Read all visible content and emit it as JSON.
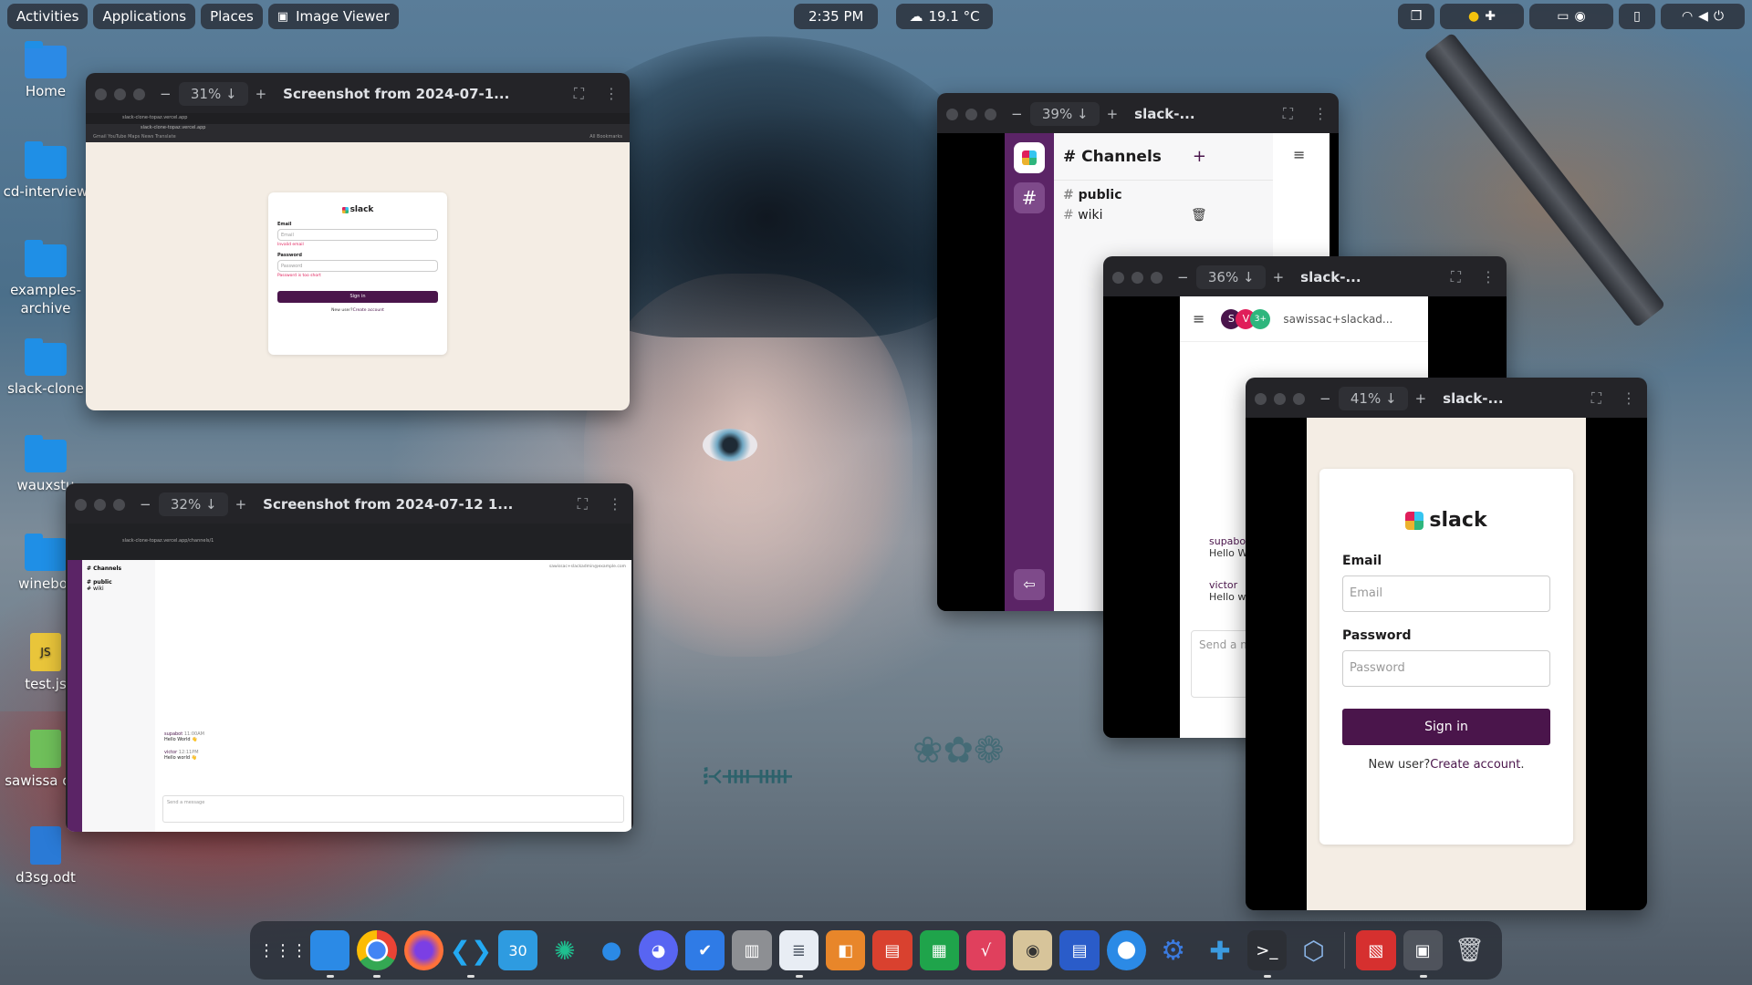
{
  "topbar": {
    "activities": "Activities",
    "applications": "Applications",
    "places": "Places",
    "app_indicator": "Image Viewer",
    "clock": "2:35 PM",
    "weather": "19.1 °C"
  },
  "desktop_icons": [
    {
      "label": "Home"
    },
    {
      "label": "cd-interview"
    },
    {
      "label": "examples-archive"
    },
    {
      "label": "slack-clone"
    },
    {
      "label": "wauxstu"
    },
    {
      "label": "winebot"
    },
    {
      "label": "test.js",
      "badge": "JS"
    },
    {
      "label": "sawissa ods"
    },
    {
      "label": "d3sg.odt"
    }
  ],
  "win1": {
    "zoom": "31%",
    "title": "Screenshot from 2024-07-1...",
    "tab": "slack-clone-topaz.vercel.app",
    "url": "slack-clone-topaz.vercel.app",
    "bookmarks": "Gmail  YouTube  Maps  News  Translate",
    "all_bookmarks": "All Bookmarks",
    "logo": "slack",
    "email_label": "Email",
    "email_placeholder": "Email",
    "email_error": "Invalid email",
    "password_label": "Password",
    "password_placeholder": "Password",
    "password_error": "Password is too short",
    "signin": "Sign in",
    "new_user": "New user?",
    "create": "Create account"
  },
  "win2": {
    "zoom": "32%",
    "title": "Screenshot from 2024-07-12 1...",
    "url": "slack-clone-topaz.vercel.app/channels/1",
    "channels_title": "# Channels",
    "channels": [
      "public",
      "wiki"
    ],
    "user_email": "sawissac+slackadmin@example.com",
    "msg1_user": "supabot",
    "msg1_time": "11:00AM",
    "msg1_text": "Hello World 👋",
    "msg2_user": "victor",
    "msg2_time": "12:11PM",
    "msg2_text": "Hello world 👋",
    "composer": "Send a message"
  },
  "win3": {
    "zoom": "39%",
    "title": "slack-...",
    "channels_title": "# Channels",
    "channels": [
      "public",
      "wiki"
    ]
  },
  "win4": {
    "zoom": "36%",
    "title": "slack-...",
    "avatars": [
      "S",
      "V",
      "3+"
    ],
    "user_email": "sawissac+slackad...",
    "msg1_user": "supabo",
    "msg1_text": "Hello W",
    "msg2_user": "victor",
    "msg2_text": "Hello w",
    "composer": "Send a m"
  },
  "win5": {
    "zoom": "41%",
    "title": "slack-...",
    "logo": "slack",
    "email_label": "Email",
    "email_placeholder": "Email",
    "password_label": "Password",
    "password_placeholder": "Password",
    "signin": "Sign in",
    "new_user": "New user?",
    "create": "Create account",
    "period": "."
  },
  "dock": {
    "apps": [
      "app-grid",
      "files",
      "chrome",
      "firefox",
      "vscode",
      "calendar",
      "aperture",
      "chat",
      "discord",
      "tasks",
      "book",
      "text-editor",
      "impress-draw",
      "impress",
      "calc",
      "math",
      "speaker",
      "writer",
      "help",
      "settings",
      "extensions",
      "terminal",
      "disk-utility",
      "pdf-viewer",
      "image-viewer",
      "trash"
    ],
    "calendar_day": "30"
  },
  "colors": {
    "slack_purple": "#4a154b",
    "sidebar_purple": "#5b2466",
    "error_red": "#e01e5a"
  }
}
